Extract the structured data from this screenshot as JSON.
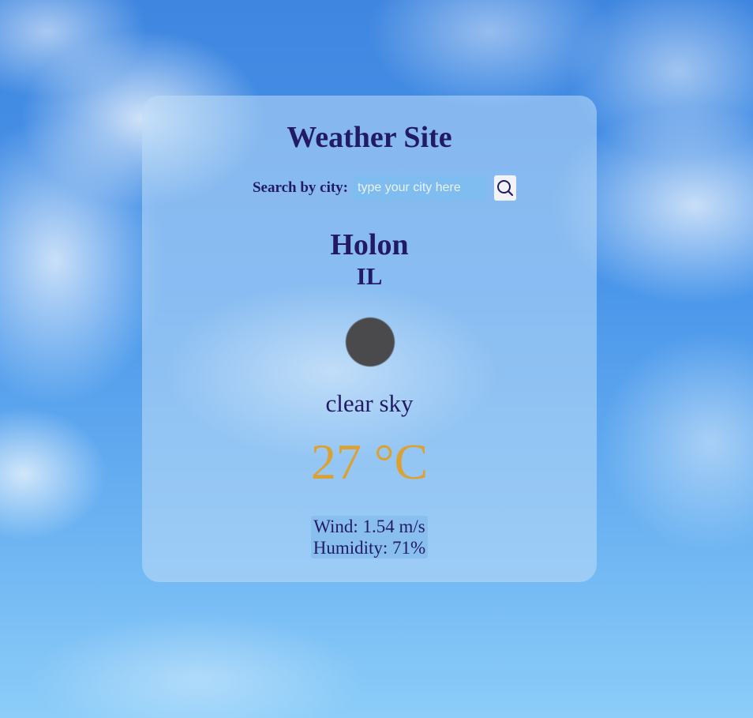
{
  "header": {
    "title": "Weather Site"
  },
  "search": {
    "label": "Search by city:",
    "placeholder": "type your city here",
    "value": "",
    "button_icon": "search-icon"
  },
  "location": {
    "city": "Holon",
    "country": "IL"
  },
  "weather": {
    "icon": "weather-condition-icon",
    "description": "clear sky",
    "temperature": "27 °C",
    "wind": "Wind: 1.54 m/s",
    "humidity": "Humidity: 71%"
  },
  "colors": {
    "text": "#231a66",
    "temperature": "#dba233",
    "card": "rgba(190, 220, 248, 0.55)",
    "input_background": "#7fbcf0",
    "stats_background": "#89bfee"
  }
}
